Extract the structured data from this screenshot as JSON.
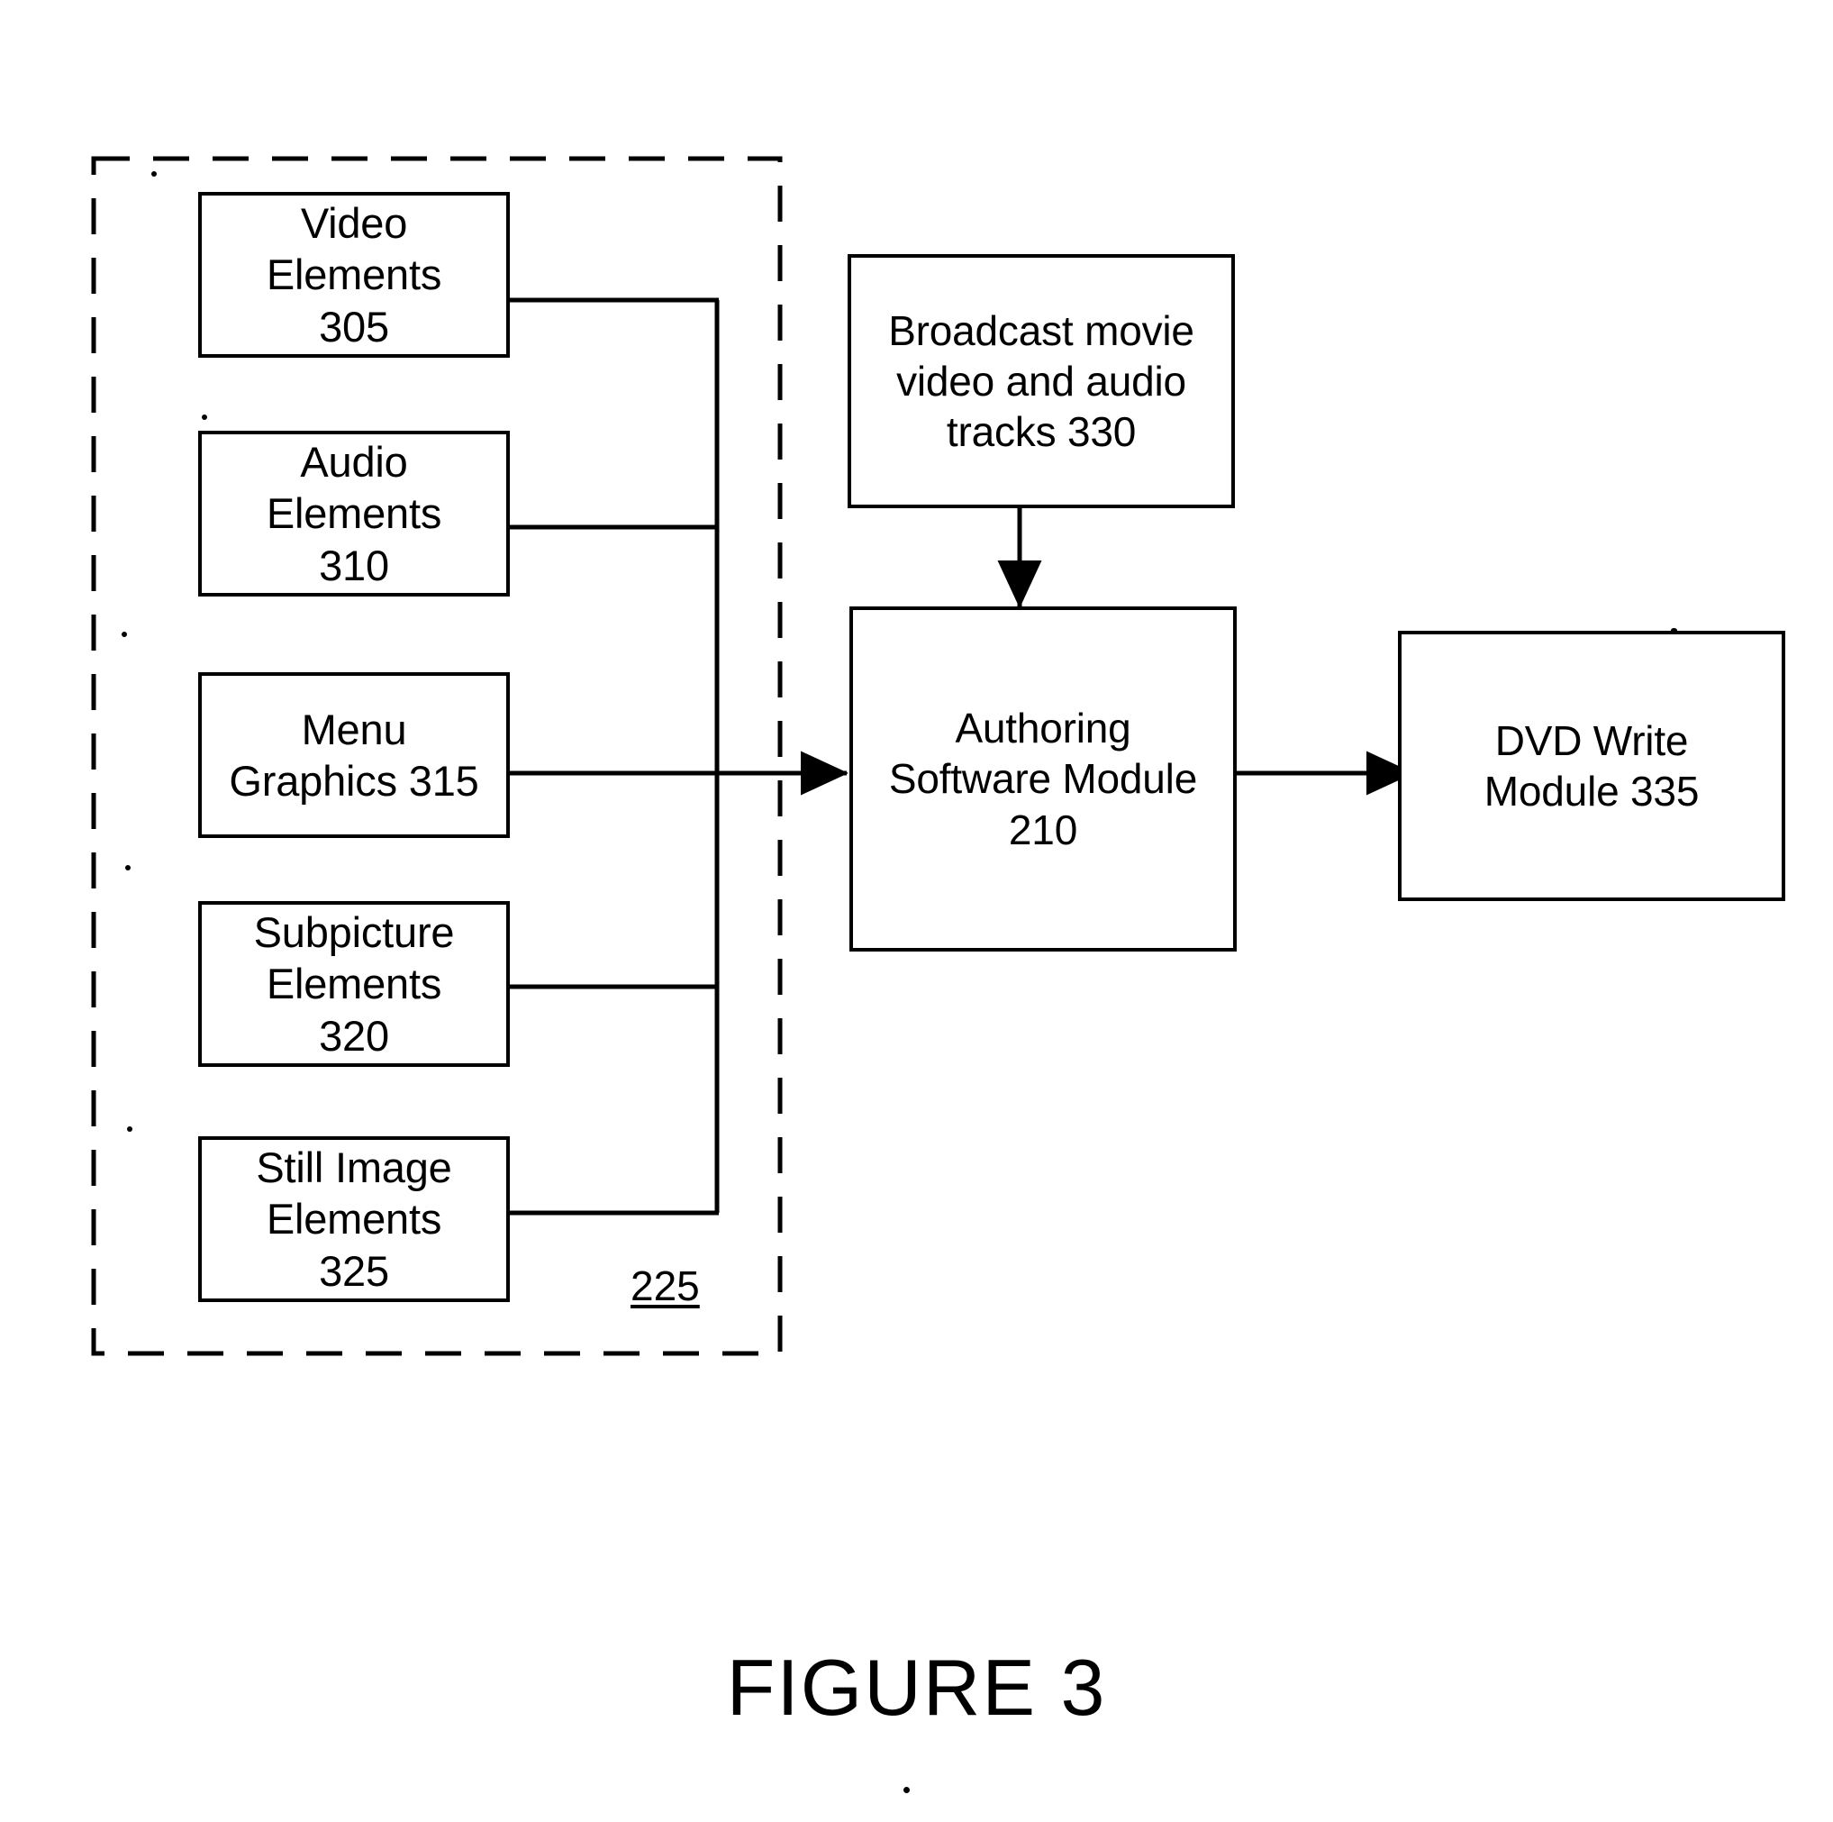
{
  "figure": {
    "caption": "FIGURE 3",
    "group_ref": "225"
  },
  "nodes": {
    "video_elements": {
      "line1": "Video",
      "line2": "Elements",
      "line3": "305"
    },
    "audio_elements": {
      "line1": "Audio",
      "line2": "Elements",
      "line3": "310"
    },
    "menu_graphics": {
      "line1": "Menu",
      "line2": "Graphics 315",
      "line3": ""
    },
    "subpicture_elements": {
      "line1": "Subpicture",
      "line2": "Elements",
      "line3": "320"
    },
    "still_image_elements": {
      "line1": "Still Image",
      "line2": "Elements",
      "line3": "325"
    },
    "broadcast_tracks": {
      "line1": "Broadcast movie",
      "line2": "video and audio",
      "line3": "tracks 330"
    },
    "authoring_module": {
      "line1": "Authoring",
      "line2": "Software Module",
      "line3": "210"
    },
    "dvd_write_module": {
      "line1": "DVD Write",
      "line2": "Module 335",
      "line3": ""
    }
  },
  "colors": {
    "stroke": "#000000",
    "background": "#ffffff"
  }
}
